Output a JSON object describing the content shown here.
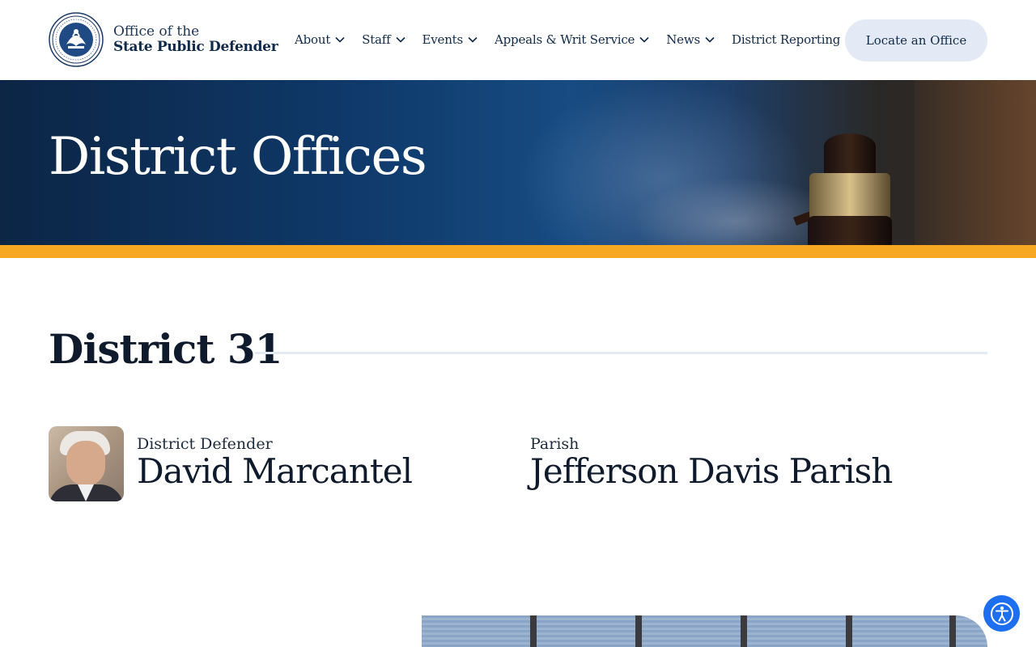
{
  "header": {
    "logo_line1": "Office of the",
    "logo_line2": "State Public Defender",
    "logo_icon": "louisiana-state-seal",
    "nav": [
      {
        "label": "About",
        "has_dropdown": true
      },
      {
        "label": "Staff",
        "has_dropdown": true
      },
      {
        "label": "Events",
        "has_dropdown": true
      },
      {
        "label": "Appeals & Writ Service",
        "has_dropdown": true
      },
      {
        "label": "News",
        "has_dropdown": true
      },
      {
        "label": "District Reporting",
        "has_dropdown": false
      }
    ],
    "cta_label": "Locate an Office"
  },
  "hero": {
    "title": "District Offices",
    "image": "gavel-courtroom-photo"
  },
  "district": {
    "title": "District 31",
    "defender_label": "District Defender",
    "defender_name": "David Marcantel",
    "parish_label": "Parish",
    "parish_name": "Jefferson Davis Parish"
  },
  "colors": {
    "navy": "#0f2a4a",
    "accent_gold": "#f7a823",
    "cta_bg": "#e3eaf5",
    "a11y_blue": "#1d6ff0"
  },
  "icons": {
    "dropdown": "chevron-down-icon",
    "accessibility": "accessibility-icon"
  }
}
